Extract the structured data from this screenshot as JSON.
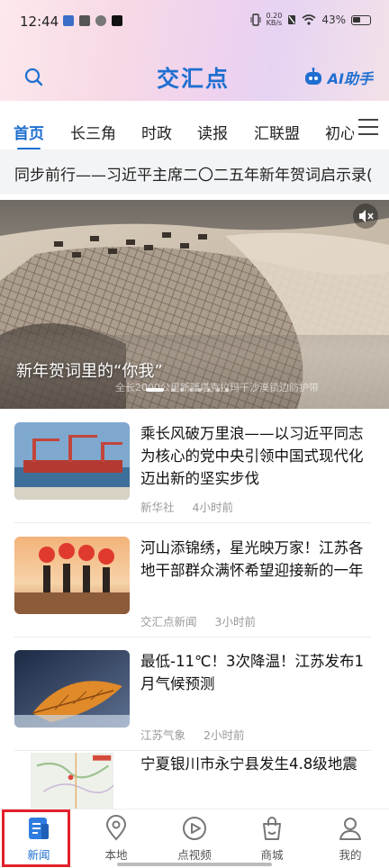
{
  "status_bar": {
    "time": "12:44",
    "net_speed": "0.20",
    "net_unit": "KB/s",
    "battery": "43%"
  },
  "header": {
    "logo": "交汇点",
    "ai_label": "AI助手"
  },
  "tabs": [
    {
      "label": "首页",
      "active": true
    },
    {
      "label": "长三角"
    },
    {
      "label": "时政"
    },
    {
      "label": "读报"
    },
    {
      "label": "汇联盟"
    },
    {
      "label": "初心"
    }
  ],
  "ticker": {
    "text": "同步前行——习近平主席二〇二五年新年贺词启示录("
  },
  "hero": {
    "title": "新年贺词里的“你我”",
    "caption": "全长2000公里新疆塔克拉玛干沙漠锁边防护带"
  },
  "news": [
    {
      "title": "乘长风破万里浪——以习近平同志为核心的党中央引领中国式现代化迈出新的坚实步伐",
      "source": "新华社",
      "time": "4小时前"
    },
    {
      "title": "河山添锦绣，星光映万家！江苏各地干部群众满怀希望迎接新的一年",
      "source": "交汇点新闻",
      "time": "3小时前"
    },
    {
      "title": "最低-11℃！3次降温！江苏发布1月气候预测",
      "source": "江苏气象",
      "time": "2小时前"
    },
    {
      "title": "宁夏银川市永宁县发生4.8级地震",
      "source": "",
      "time": ""
    }
  ],
  "bottom_nav": [
    {
      "label": "新闻",
      "icon": "news-icon",
      "active": true
    },
    {
      "label": "本地",
      "icon": "location-icon"
    },
    {
      "label": "点视频",
      "icon": "play-icon"
    },
    {
      "label": "商城",
      "icon": "shopping-bag-icon"
    },
    {
      "label": "我的",
      "icon": "user-icon"
    }
  ],
  "colors": {
    "accent": "#1f6fd0",
    "highlight": "#e4202a"
  }
}
